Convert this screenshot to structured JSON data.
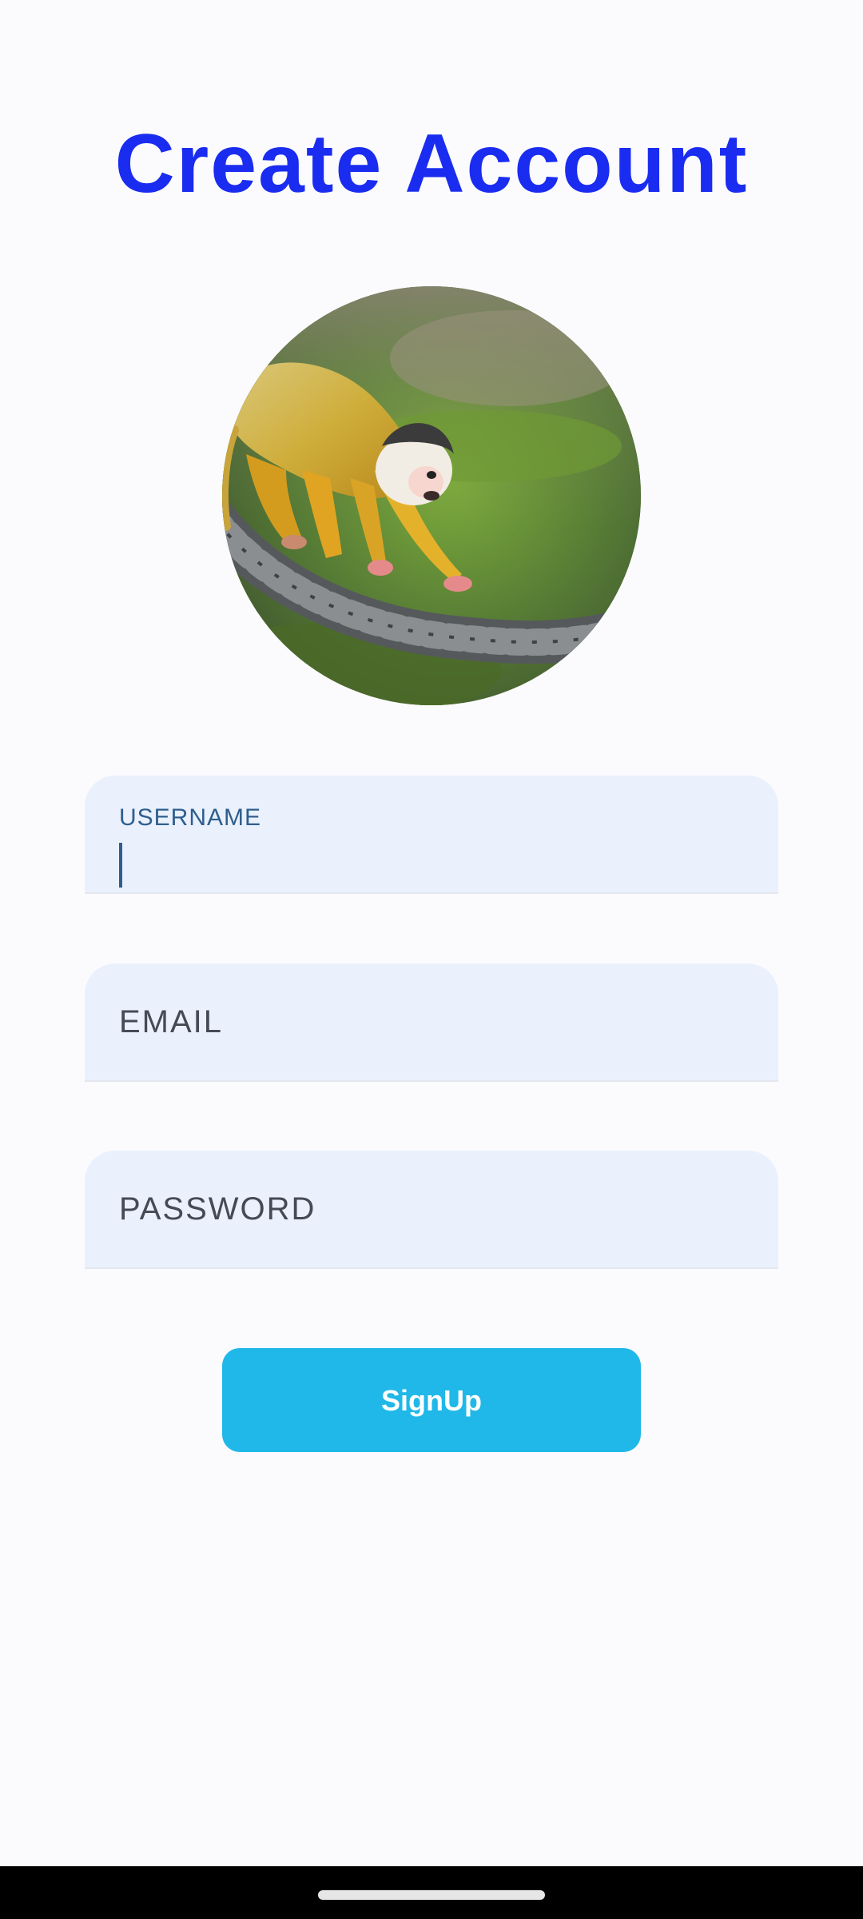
{
  "header": {
    "title": "Create Account"
  },
  "avatar": {
    "camera_icon": "camera-icon"
  },
  "form": {
    "username": {
      "label": "USERNAME",
      "value": ""
    },
    "email": {
      "placeholder": "EMAIL",
      "value": ""
    },
    "password": {
      "placeholder": "PASSWORD",
      "value": ""
    },
    "submit_label": "SignUp"
  },
  "colors": {
    "title": "#1a2cf0",
    "field_background": "#eaf1fd",
    "focused_accent": "#2f5e8e",
    "button": "#20b8e8",
    "page_background": "#fbfbfe"
  }
}
